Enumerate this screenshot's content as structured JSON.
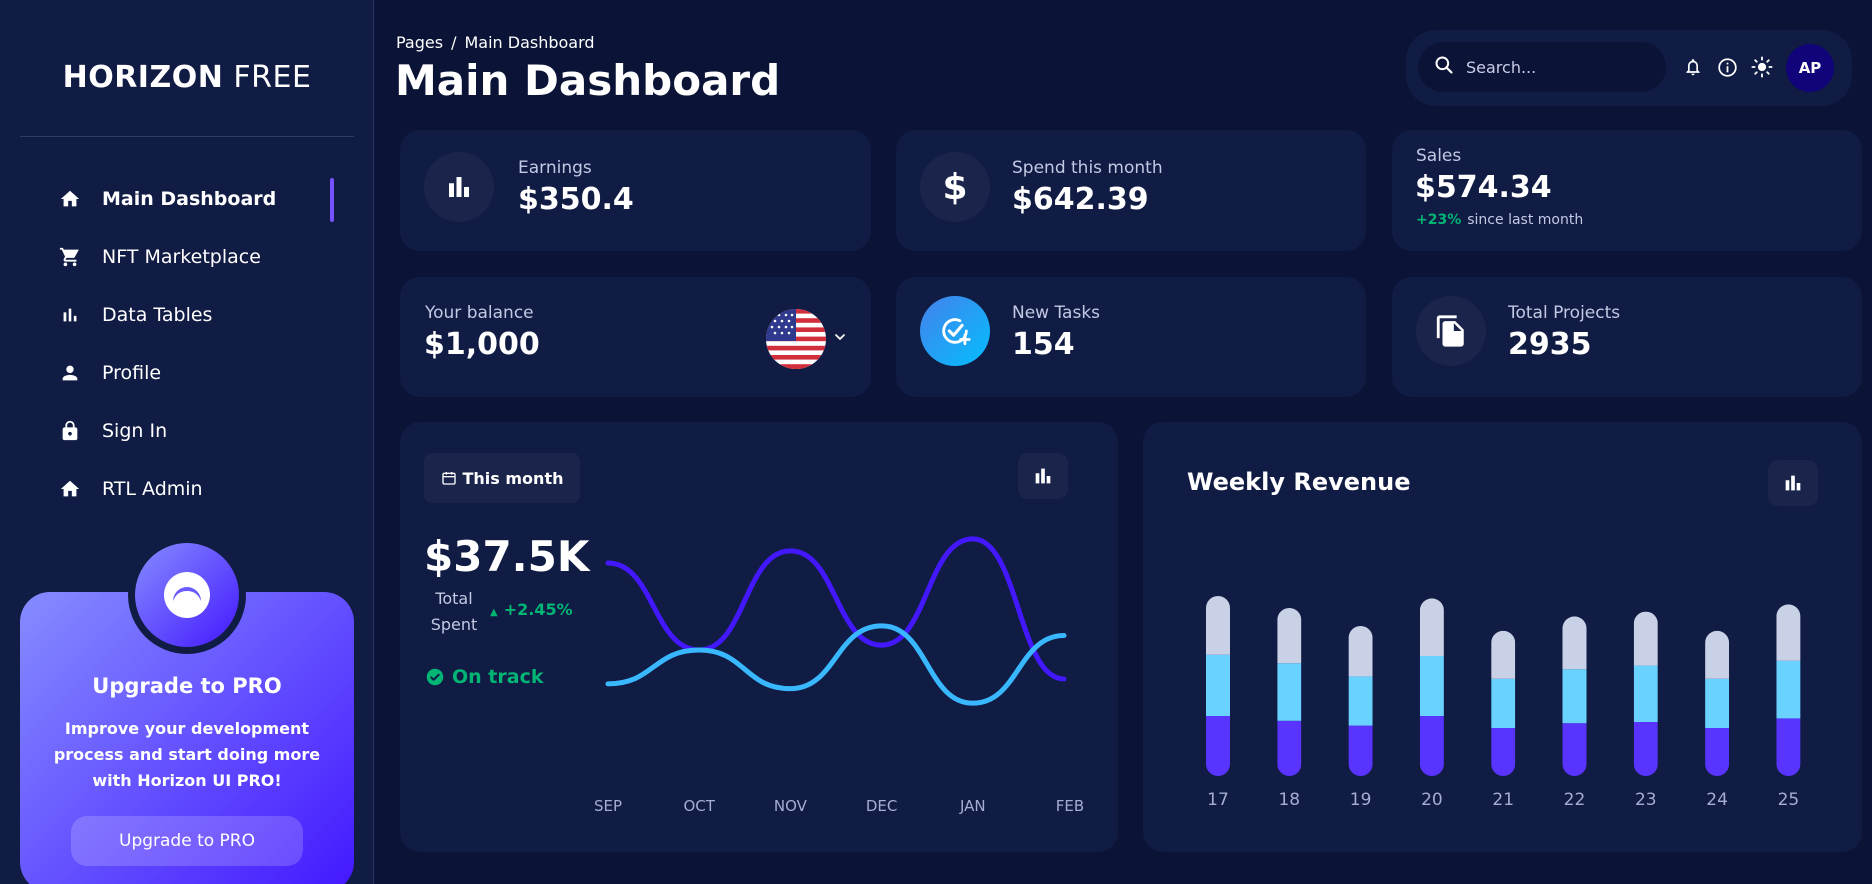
{
  "sidebar": {
    "brand_bold": "HORIZON",
    "brand_light": "FREE",
    "items": [
      {
        "label": "Main Dashboard",
        "icon": "home-icon"
      },
      {
        "label": "NFT Marketplace",
        "icon": "cart-icon"
      },
      {
        "label": "Data Tables",
        "icon": "bar-chart-icon"
      },
      {
        "label": "Profile",
        "icon": "person-icon"
      },
      {
        "label": "Sign In",
        "icon": "lock-icon"
      },
      {
        "label": "RTL Admin",
        "icon": "home-icon"
      }
    ],
    "promo": {
      "title": "Upgrade to PRO",
      "text": "Improve your development process and start doing more with Horizon UI PRO!",
      "button": "Upgrade to PRO"
    }
  },
  "header": {
    "breadcrumb_root": "Pages",
    "breadcrumb_sep": "/",
    "breadcrumb_current": "Main Dashboard",
    "title": "Main Dashboard",
    "search_placeholder": "Search...",
    "avatar_initials": "AP"
  },
  "stats": {
    "earnings": {
      "label": "Earnings",
      "value": "$350.4"
    },
    "spend": {
      "label": "Spend this month",
      "value": "$642.39"
    },
    "sales": {
      "label": "Sales",
      "value": "$574.34",
      "change": "+23%",
      "change_text": "since last month"
    },
    "balance": {
      "label": "Your balance",
      "value": "$1,000"
    },
    "tasks": {
      "label": "New Tasks",
      "value": "154"
    },
    "projects": {
      "label": "Total Projects",
      "value": "2935"
    }
  },
  "total_spent": {
    "period_button": "This month",
    "value": "$37.5K",
    "label": "Total Spent",
    "change": "+2.45%",
    "status": "On track"
  },
  "weekly_revenue": {
    "title": "Weekly Revenue"
  },
  "colors": {
    "accent": "#7551ff",
    "brand": "#4318ff",
    "positive": "#01b574",
    "line1": "#4318ff",
    "line2": "#39b8ff",
    "bar_bottom": "#5934ff",
    "bar_middle": "#6ad2ff",
    "bar_top": "#e9edf7"
  },
  "chart_data": [
    {
      "type": "line",
      "x": [
        "SEP",
        "OCT",
        "NOV",
        "DEC",
        "JAN",
        "FEB"
      ],
      "series": [
        {
          "values": [
            100,
            64,
            105,
            66,
            110,
            52
          ]
        },
        {
          "values": [
            50,
            64,
            48,
            74,
            42,
            70
          ]
        }
      ]
    },
    {
      "type": "bar",
      "title": "Weekly Revenue",
      "categories": [
        "17",
        "18",
        "19",
        "20",
        "21",
        "22",
        "23",
        "24",
        "25"
      ],
      "series": [
        {
          "values": [
            50,
            46,
            42,
            50,
            40,
            44,
            45,
            40,
            48
          ]
        },
        {
          "values": [
            51,
            48,
            41,
            50,
            41,
            45,
            47,
            41,
            48
          ]
        },
        {
          "values": [
            49,
            46,
            42,
            48,
            40,
            44,
            45,
            40,
            47
          ]
        }
      ]
    }
  ]
}
